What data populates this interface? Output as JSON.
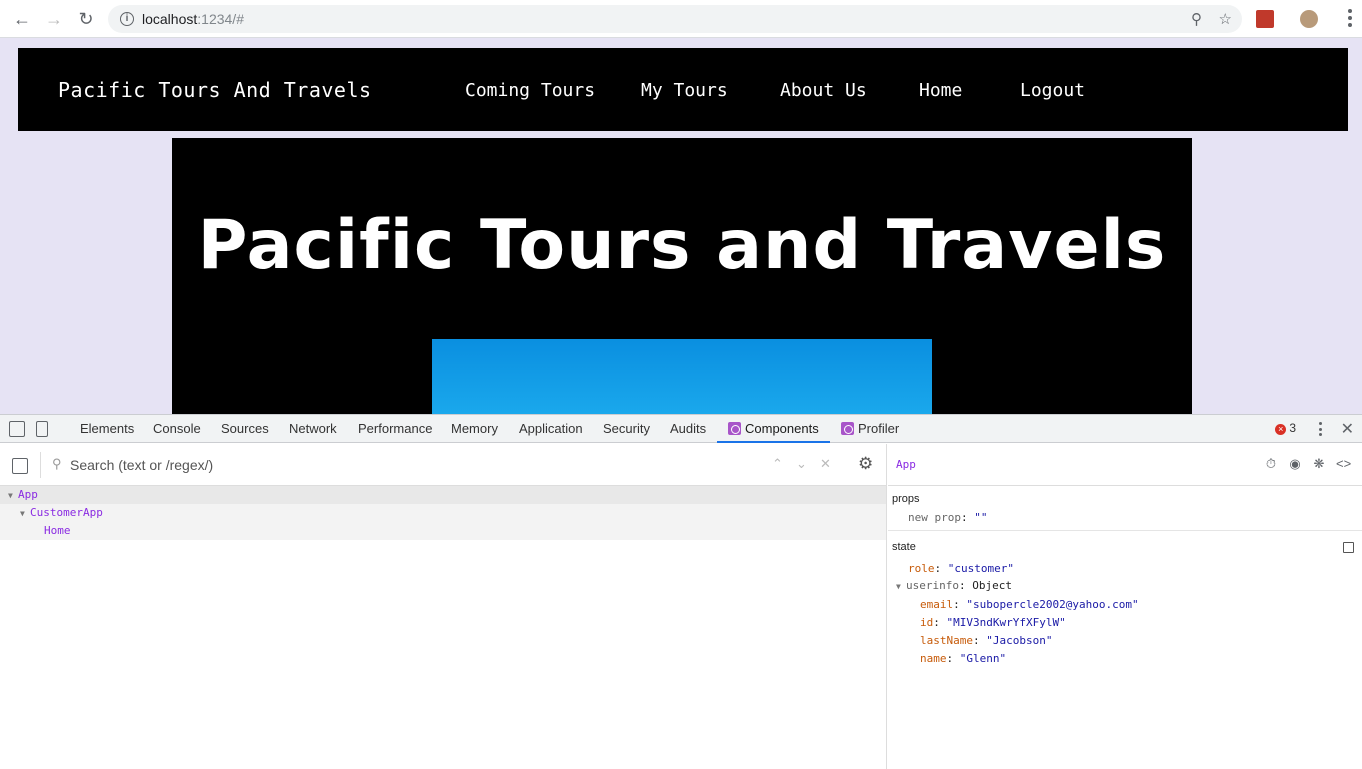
{
  "browser": {
    "url_host": "localhost",
    "url_path": ":1234/#"
  },
  "site": {
    "brand": "Pacific Tours And Travels",
    "nav": [
      "Coming Tours",
      "My Tours",
      "About Us",
      "Home",
      "Logout"
    ],
    "hero_title": "Pacific Tours and Travels"
  },
  "devtools": {
    "tabs": [
      "Elements",
      "Console",
      "Sources",
      "Network",
      "Performance",
      "Memory",
      "Application",
      "Security",
      "Audits",
      "Components",
      "Profiler"
    ],
    "active_tab": "Components",
    "error_count": "3",
    "search_placeholder": "Search (text or /regex/)",
    "tree": [
      "App",
      "CustomerApp",
      "Home"
    ],
    "selected_component": "App",
    "props_label": "props",
    "props": {
      "key": "new prop",
      "value": "\"\""
    },
    "state_label": "state",
    "state": {
      "role_key": "role",
      "role_value": "\"customer\"",
      "userinfo_key": "userinfo",
      "userinfo_type": "Object",
      "fields": [
        {
          "key": "email",
          "value": "\"subopercle2002@yahoo.com\""
        },
        {
          "key": "id",
          "value": "\"MIV3ndKwrYfXFylW\""
        },
        {
          "key": "lastName",
          "value": "\"Jacobson\""
        },
        {
          "key": "name",
          "value": "\"Glenn\""
        }
      ]
    }
  }
}
